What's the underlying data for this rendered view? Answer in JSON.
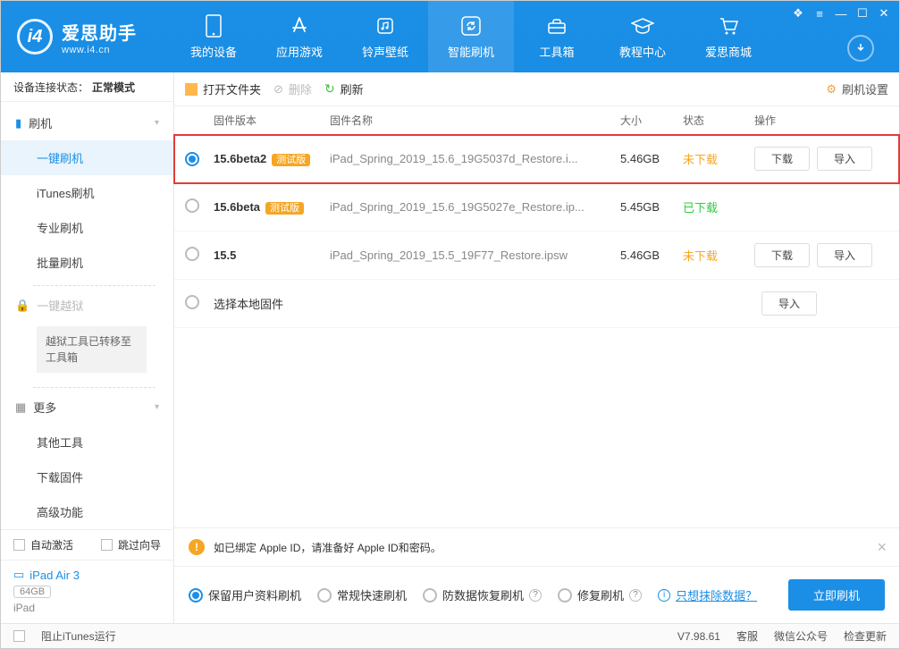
{
  "app": {
    "name": "爱思助手",
    "url": "www.i4.cn",
    "version": "V7.98.61"
  },
  "topnav": {
    "items": [
      {
        "label": "我的设备"
      },
      {
        "label": "应用游戏"
      },
      {
        "label": "铃声壁纸"
      },
      {
        "label": "智能刷机"
      },
      {
        "label": "工具箱"
      },
      {
        "label": "教程中心"
      },
      {
        "label": "爱思商城"
      }
    ]
  },
  "sidebar": {
    "conn_label": "设备连接状态：",
    "conn_value": "正常模式",
    "flash_head": "刷机",
    "flash_items": [
      "一键刷机",
      "iTunes刷机",
      "专业刷机",
      "批量刷机"
    ],
    "jail_head": "一键越狱",
    "jail_note": "越狱工具已转移至工具箱",
    "more_head": "更多",
    "more_items": [
      "其他工具",
      "下载固件",
      "高级功能"
    ],
    "auto_activate": "自动激活",
    "skip_wizard": "跳过向导",
    "device": {
      "name": "iPad Air 3",
      "storage": "64GB",
      "type": "iPad"
    }
  },
  "toolbar": {
    "open": "打开文件夹",
    "delete": "删除",
    "refresh": "刷新",
    "settings": "刷机设置"
  },
  "table": {
    "head": {
      "version": "固件版本",
      "name": "固件名称",
      "size": "大小",
      "status": "状态",
      "action": "操作"
    },
    "rows": [
      {
        "selected": true,
        "highlight": true,
        "version": "15.6beta2",
        "badge": "测试版",
        "name": "iPad_Spring_2019_15.6_19G5037d_Restore.i...",
        "size": "5.46GB",
        "status": "未下载",
        "status_cls": "stat-undown",
        "download": "下载",
        "import": "导入"
      },
      {
        "selected": false,
        "highlight": false,
        "version": "15.6beta",
        "badge": "测试版",
        "name": "iPad_Spring_2019_15.6_19G5027e_Restore.ip...",
        "size": "5.45GB",
        "status": "已下载",
        "status_cls": "stat-down",
        "download": "",
        "import": ""
      },
      {
        "selected": false,
        "highlight": false,
        "version": "15.5",
        "badge": "",
        "name": "iPad_Spring_2019_15.5_19F77_Restore.ipsw",
        "size": "5.46GB",
        "status": "未下载",
        "status_cls": "stat-undown",
        "download": "下载",
        "import": "导入"
      }
    ],
    "local": {
      "label": "选择本地固件",
      "import": "导入"
    }
  },
  "notice": "如已绑定 Apple ID，请准备好 Apple ID和密码。",
  "options": {
    "opt1": "保留用户资料刷机",
    "opt2": "常规快速刷机",
    "opt3": "防数据恢复刷机",
    "opt4": "修复刷机",
    "erase_link": "只想抹除数据？",
    "go": "立即刷机"
  },
  "status": {
    "block_itunes": "阻止iTunes运行",
    "kefu": "客服",
    "wechat": "微信公众号",
    "update": "检查更新"
  }
}
